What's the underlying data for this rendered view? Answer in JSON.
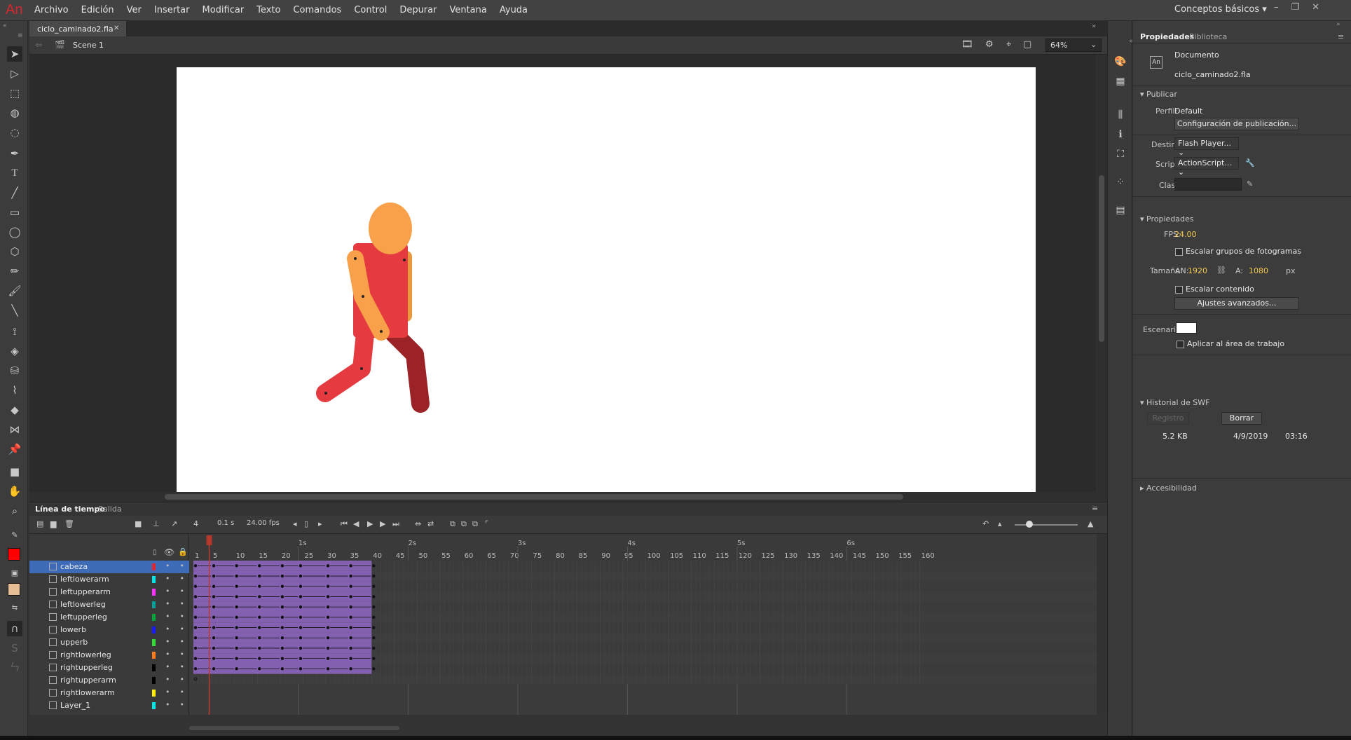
{
  "app": {
    "logo": "An",
    "workspace": "Conceptos básicos"
  },
  "menu": [
    "Archivo",
    "Edición",
    "Ver",
    "Insertar",
    "Modificar",
    "Texto",
    "Comandos",
    "Control",
    "Depurar",
    "Ventana",
    "Ayuda"
  ],
  "document": {
    "tab": "ciclo_caminado2.fla",
    "scene": "Scene 1",
    "zoom": "64%"
  },
  "timeline": {
    "tabs": [
      "Línea de tiempo",
      "Salida"
    ],
    "current_frame": "4",
    "elapsed": "0.1 s",
    "fps": "24.00 fps",
    "frame_ticks": [
      "1",
      "5",
      "10",
      "15",
      "20",
      "25",
      "30",
      "35",
      "40",
      "45",
      "50",
      "55",
      "60",
      "65",
      "70",
      "75",
      "80",
      "85",
      "90",
      "95",
      "100",
      "105",
      "110",
      "115",
      "120",
      "125",
      "130",
      "135",
      "140",
      "145",
      "150",
      "155",
      "160"
    ],
    "second_marks": [
      "1s",
      "2s",
      "3s",
      "4s",
      "5s",
      "6s"
    ],
    "layers": [
      {
        "name": "cabeza",
        "color": "#e0262e",
        "selected": true
      },
      {
        "name": "leftlowerarm",
        "color": "#00e5e5"
      },
      {
        "name": "leftupperarm",
        "color": "#ff33ff"
      },
      {
        "name": "leftlowerleg",
        "color": "#00a09a"
      },
      {
        "name": "leftupperleg",
        "color": "#00a33a"
      },
      {
        "name": "lowerb",
        "color": "#1a1aff"
      },
      {
        "name": "upperb",
        "color": "#33dd33"
      },
      {
        "name": "rightlowerleg",
        "color": "#ff7b1a"
      },
      {
        "name": "rightupperleg",
        "color": "#000000"
      },
      {
        "name": "rightupperarm",
        "color": "#000000"
      },
      {
        "name": "rightlowerarm",
        "color": "#ffee00"
      },
      {
        "name": "Layer_1",
        "color": "#00e5e5"
      }
    ]
  },
  "properties": {
    "tabs": [
      "Propiedades",
      "Biblioteca"
    ],
    "doc_icon": "An",
    "doc_type": "Documento",
    "doc_name": "ciclo_caminado2.fla",
    "publish": {
      "section": "Publicar",
      "profile_label": "Perfil:",
      "profile": "Default",
      "settings_button": "Configuración de publicación...",
      "target_label": "Destino:",
      "target": "Flash Player...",
      "script_label": "Script:",
      "script": "ActionScript...",
      "class_label": "Clase:"
    },
    "props": {
      "section": "Propiedades",
      "fps_label": "FPS:",
      "fps": "24.00",
      "scale_groups": "Escalar grupos de fotogramas",
      "size_label": "Tamaño:",
      "w_label": "AN:",
      "width": "1920",
      "h_label": "A:",
      "height": "1080",
      "unit": "px",
      "scale_content": "Escalar contenido",
      "advanced_button": "Ajustes avanzados...",
      "stage_label": "Escenario:",
      "stage_color": "#ffffff",
      "apply_area": "Aplicar al área de trabajo"
    },
    "swf": {
      "section": "Historial de SWF",
      "log_button": "Registro",
      "clear_button": "Borrar",
      "size": "5.2 KB",
      "date": "4/9/2019",
      "time": "03:16"
    },
    "accessibility": "Accesibilidad"
  },
  "colors": {
    "stroke": "#ff0000",
    "fill": "#e8bf94",
    "frames": "#8460b0",
    "playhead": "#c0392b"
  }
}
